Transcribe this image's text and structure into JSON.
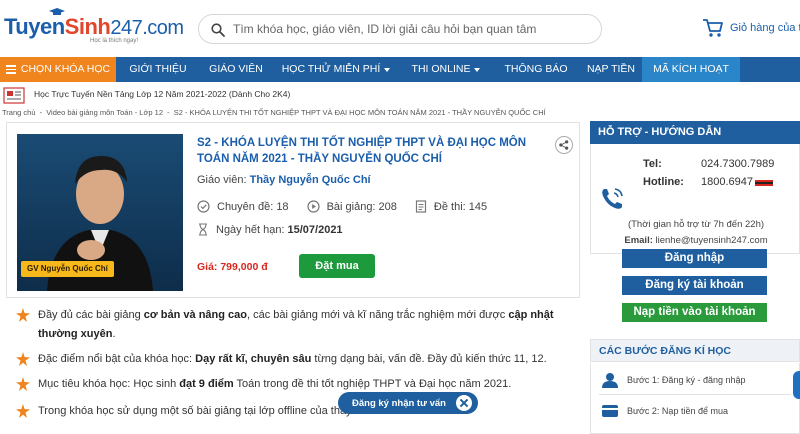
{
  "header": {
    "logo": {
      "part1": "Tuyen",
      "part2": "Sinh",
      "part3": "247.com",
      "tagline": "Học là thích ngay!"
    },
    "search": {
      "placeholder": "Tìm khóa học, giáo viên, ID lời giải câu hỏi bạn quan tâm"
    },
    "cart_label": "Giỏ hàng của tôi"
  },
  "nav": {
    "items": [
      {
        "label": "CHỌN KHÓA HỌC",
        "has_caret": false,
        "hamburger": true
      },
      {
        "label": "GIỚI THIỆU"
      },
      {
        "label": "GIÁO VIÊN"
      },
      {
        "label": "HỌC THỬ MIỄN PHÍ",
        "has_caret": true
      },
      {
        "label": "THI ONLINE",
        "has_caret": true
      },
      {
        "label": "THÔNG BÁO"
      },
      {
        "label": "NẠP TIỀN"
      },
      {
        "label": "MÃ KÍCH HOẠT"
      }
    ]
  },
  "subbar": {
    "text": "Học Trực Tuyến Nền Tảng Lớp 12 Năm 2021-2022 (Dành Cho 2K4)"
  },
  "breadcrumb": {
    "items": [
      "Trang chủ",
      "-",
      "Video bài giảng môn Toán - Lớp 12",
      "-",
      "S2 - KHÓA LUYỆN THI TỐT NGHIỆP THPT VÀ ĐẠI HỌC MÔN TOÁN NĂM 2021 - THẦY NGUYỄN QUỐC CHÍ"
    ]
  },
  "course": {
    "photo_label": "GV Nguyễn Quốc Chí",
    "title": "S2 - KHÓA LUYỆN THI TỐT NGHIỆP THPT VÀ ĐẠI HỌC MÔN TOÁN NĂM 2021 - THẦY NGUYỄN QUỐC CHÍ",
    "teacher_prefix": "Giáo viên:",
    "teacher_name": "Thầy Nguyễn Quốc Chí",
    "topics": "Chuyên đề: 18",
    "lessons": "Bài giảng: 208",
    "exams": "Đề thi: 145",
    "expiry_label": "Ngày hết hạn:",
    "expiry_date": "15/07/2021",
    "price": "Giá: 799,000 đ",
    "buy_label": "Đặt mua"
  },
  "description": {
    "d1_a": "Đầy đủ các bài giảng",
    "d1_b": "cơ bản và nâng cao",
    "d1_c": ", các bài giảng mới và kĩ năng trắc nghiệm mới được",
    "d1_d": "cập nhật thường xuyên",
    "d1_e": ".",
    "d2_a": "Đặc điểm nổi bật của khóa học:",
    "d2_b": "Dạy rất kĩ, chuyên sâu",
    "d2_c": "từng dạng bài, vấn đề. Đầy đủ kiến thức 11, 12.",
    "d3_a": "Mục tiêu khóa học: Học sinh",
    "d3_b": "đạt 9 điểm",
    "d3_c": "Toán trong đề thi tốt nghiệp THPT và Đại học năm 2021.",
    "d4": "Trong khóa học sử dụng một số bài giảng tại lớp offline của thầy Chí."
  },
  "consult_label": "Đăng ký nhận tư vấn",
  "sidebar": {
    "support_title": "HỖ TRỢ - HƯỚNG DẪN",
    "tel_label": "Tel:",
    "tel_value": "024.7300.7989",
    "hotline_label": "Hotline:",
    "hotline_value": "1800.6947",
    "hours": "(Thời gian hỗ trợ từ 7h đến 22h)",
    "email_label": "Email:",
    "email_value": "lienhe@tuyensinh247.com",
    "login": "Đăng nhập",
    "register": "Đăng ký tài khoản",
    "topup": "Nạp tiền vào tài khoản",
    "steps_title": "CÁC BƯỚC ĐĂNG KÍ HỌC",
    "step1": "Bước 1: Đăng ký - đăng nhập",
    "step2": "Bước 2: Nạp tiền để mua"
  },
  "colors": {
    "brand_blue": "#1f5f9f",
    "orange": "#f0841d",
    "green": "#1d9a3b",
    "price_red": "#d9261c"
  }
}
